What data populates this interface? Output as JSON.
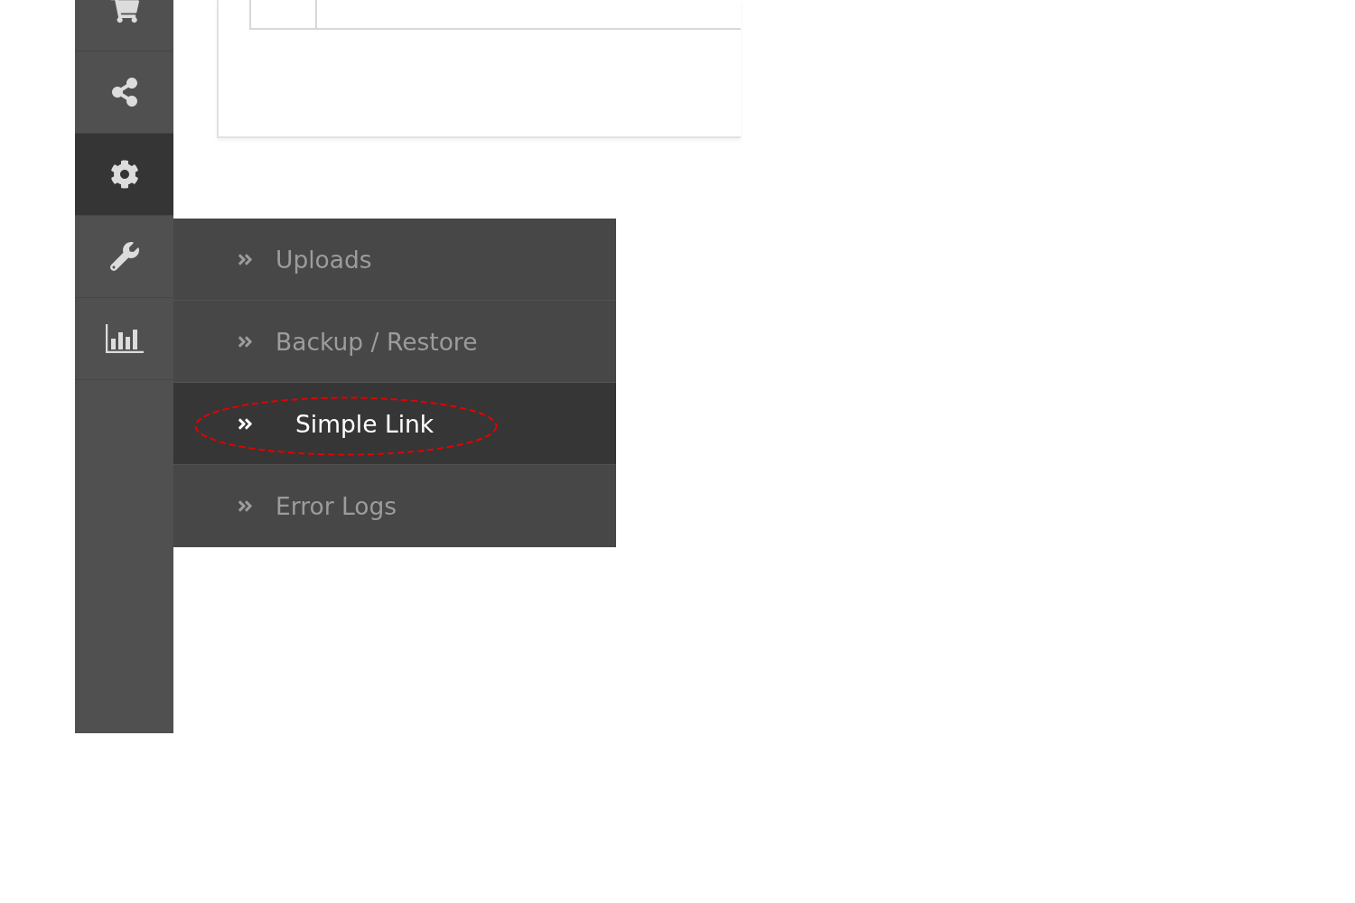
{
  "sidebar": {
    "items": [
      {
        "kind": "cart",
        "selected": false
      },
      {
        "kind": "share",
        "selected": false
      },
      {
        "kind": "gear",
        "selected": true
      },
      {
        "kind": "wrench",
        "selected": false
      },
      {
        "kind": "chart",
        "selected": false
      }
    ]
  },
  "submenu": {
    "items": [
      {
        "label": "Uploads",
        "selected": false,
        "circled": false
      },
      {
        "label": "Backup / Restore",
        "selected": false,
        "circled": false
      },
      {
        "label": "Simple Link",
        "selected": true,
        "circled": true
      },
      {
        "label": "Error Logs",
        "selected": false,
        "circled": false
      }
    ]
  }
}
